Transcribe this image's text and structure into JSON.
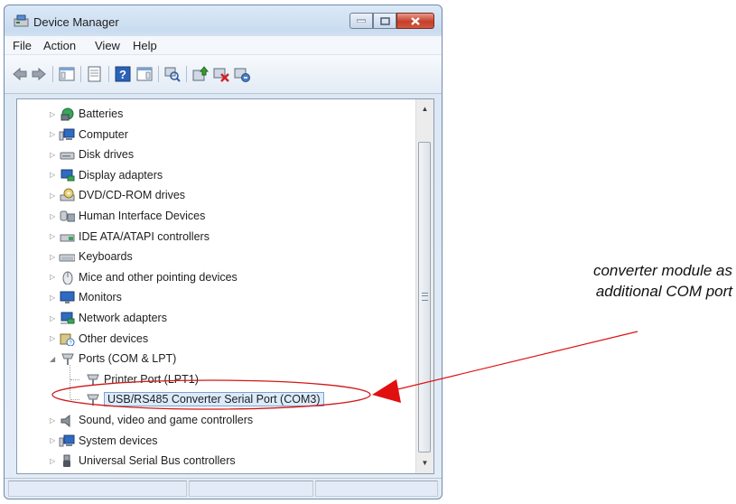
{
  "window": {
    "title": "Device Manager"
  },
  "menu": [
    "File",
    "Action",
    "View",
    "Help"
  ],
  "toolbar": {
    "icons": [
      "back-arrow-icon",
      "forward-arrow-icon",
      "show-hide-console-tree-icon",
      "properties-icon",
      "help-icon",
      "action-pane-icon",
      "scan-hardware-icon",
      "update-driver-icon",
      "disable-device-icon",
      "uninstall-device-icon"
    ]
  },
  "tree": {
    "items": [
      {
        "label": "Batteries",
        "icon": "battery-icon",
        "expanded": false
      },
      {
        "label": "Computer",
        "icon": "computer-icon",
        "expanded": false
      },
      {
        "label": "Disk drives",
        "icon": "disk-drive-icon",
        "expanded": false
      },
      {
        "label": "Display adapters",
        "icon": "display-adapter-icon",
        "expanded": false
      },
      {
        "label": "DVD/CD-ROM drives",
        "icon": "dvd-drive-icon",
        "expanded": false
      },
      {
        "label": "Human Interface Devices",
        "icon": "hid-icon",
        "expanded": false
      },
      {
        "label": "IDE ATA/ATAPI controllers",
        "icon": "ide-controller-icon",
        "expanded": false
      },
      {
        "label": "Keyboards",
        "icon": "keyboard-icon",
        "expanded": false
      },
      {
        "label": "Mice and other pointing devices",
        "icon": "mouse-icon",
        "expanded": false
      },
      {
        "label": "Monitors",
        "icon": "monitor-icon",
        "expanded": false
      },
      {
        "label": "Network adapters",
        "icon": "network-adapter-icon",
        "expanded": false
      },
      {
        "label": "Other devices",
        "icon": "unknown-device-icon",
        "expanded": false
      },
      {
        "label": "Ports (COM & LPT)",
        "icon": "port-icon",
        "expanded": true,
        "children": [
          {
            "label": "Printer Port (LPT1)",
            "icon": "port-icon"
          },
          {
            "label": "USB/RS485 Converter Serial Port (COM3)",
            "icon": "port-icon",
            "highlighted": true
          }
        ]
      },
      {
        "label": "Sound, video and game controllers",
        "icon": "speaker-icon",
        "expanded": false
      },
      {
        "label": "System devices",
        "icon": "system-device-icon",
        "expanded": false
      },
      {
        "label": "Universal Serial Bus controllers",
        "icon": "usb-icon",
        "expanded": false
      }
    ]
  },
  "annotation": {
    "line1": "converter module as",
    "line2": "additional COM port"
  },
  "colors": {
    "highlight_ring": "#d01818",
    "arrow": "#e01010",
    "selection_bg": "#dcebfc"
  }
}
